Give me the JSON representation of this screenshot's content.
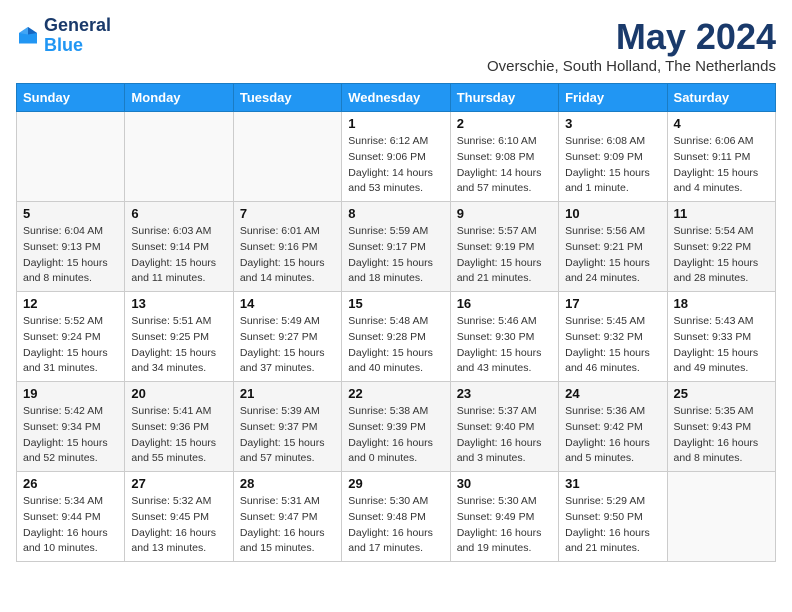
{
  "logo": {
    "line1": "General",
    "line2": "Blue"
  },
  "title": "May 2024",
  "subtitle": "Overschie, South Holland, The Netherlands",
  "days_of_week": [
    "Sunday",
    "Monday",
    "Tuesday",
    "Wednesday",
    "Thursday",
    "Friday",
    "Saturday"
  ],
  "weeks": [
    [
      {
        "day": "",
        "info": ""
      },
      {
        "day": "",
        "info": ""
      },
      {
        "day": "",
        "info": ""
      },
      {
        "day": "1",
        "info": "Sunrise: 6:12 AM\nSunset: 9:06 PM\nDaylight: 14 hours\nand 53 minutes."
      },
      {
        "day": "2",
        "info": "Sunrise: 6:10 AM\nSunset: 9:08 PM\nDaylight: 14 hours\nand 57 minutes."
      },
      {
        "day": "3",
        "info": "Sunrise: 6:08 AM\nSunset: 9:09 PM\nDaylight: 15 hours\nand 1 minute."
      },
      {
        "day": "4",
        "info": "Sunrise: 6:06 AM\nSunset: 9:11 PM\nDaylight: 15 hours\nand 4 minutes."
      }
    ],
    [
      {
        "day": "5",
        "info": "Sunrise: 6:04 AM\nSunset: 9:13 PM\nDaylight: 15 hours\nand 8 minutes."
      },
      {
        "day": "6",
        "info": "Sunrise: 6:03 AM\nSunset: 9:14 PM\nDaylight: 15 hours\nand 11 minutes."
      },
      {
        "day": "7",
        "info": "Sunrise: 6:01 AM\nSunset: 9:16 PM\nDaylight: 15 hours\nand 14 minutes."
      },
      {
        "day": "8",
        "info": "Sunrise: 5:59 AM\nSunset: 9:17 PM\nDaylight: 15 hours\nand 18 minutes."
      },
      {
        "day": "9",
        "info": "Sunrise: 5:57 AM\nSunset: 9:19 PM\nDaylight: 15 hours\nand 21 minutes."
      },
      {
        "day": "10",
        "info": "Sunrise: 5:56 AM\nSunset: 9:21 PM\nDaylight: 15 hours\nand 24 minutes."
      },
      {
        "day": "11",
        "info": "Sunrise: 5:54 AM\nSunset: 9:22 PM\nDaylight: 15 hours\nand 28 minutes."
      }
    ],
    [
      {
        "day": "12",
        "info": "Sunrise: 5:52 AM\nSunset: 9:24 PM\nDaylight: 15 hours\nand 31 minutes."
      },
      {
        "day": "13",
        "info": "Sunrise: 5:51 AM\nSunset: 9:25 PM\nDaylight: 15 hours\nand 34 minutes."
      },
      {
        "day": "14",
        "info": "Sunrise: 5:49 AM\nSunset: 9:27 PM\nDaylight: 15 hours\nand 37 minutes."
      },
      {
        "day": "15",
        "info": "Sunrise: 5:48 AM\nSunset: 9:28 PM\nDaylight: 15 hours\nand 40 minutes."
      },
      {
        "day": "16",
        "info": "Sunrise: 5:46 AM\nSunset: 9:30 PM\nDaylight: 15 hours\nand 43 minutes."
      },
      {
        "day": "17",
        "info": "Sunrise: 5:45 AM\nSunset: 9:32 PM\nDaylight: 15 hours\nand 46 minutes."
      },
      {
        "day": "18",
        "info": "Sunrise: 5:43 AM\nSunset: 9:33 PM\nDaylight: 15 hours\nand 49 minutes."
      }
    ],
    [
      {
        "day": "19",
        "info": "Sunrise: 5:42 AM\nSunset: 9:34 PM\nDaylight: 15 hours\nand 52 minutes."
      },
      {
        "day": "20",
        "info": "Sunrise: 5:41 AM\nSunset: 9:36 PM\nDaylight: 15 hours\nand 55 minutes."
      },
      {
        "day": "21",
        "info": "Sunrise: 5:39 AM\nSunset: 9:37 PM\nDaylight: 15 hours\nand 57 minutes."
      },
      {
        "day": "22",
        "info": "Sunrise: 5:38 AM\nSunset: 9:39 PM\nDaylight: 16 hours\nand 0 minutes."
      },
      {
        "day": "23",
        "info": "Sunrise: 5:37 AM\nSunset: 9:40 PM\nDaylight: 16 hours\nand 3 minutes."
      },
      {
        "day": "24",
        "info": "Sunrise: 5:36 AM\nSunset: 9:42 PM\nDaylight: 16 hours\nand 5 minutes."
      },
      {
        "day": "25",
        "info": "Sunrise: 5:35 AM\nSunset: 9:43 PM\nDaylight: 16 hours\nand 8 minutes."
      }
    ],
    [
      {
        "day": "26",
        "info": "Sunrise: 5:34 AM\nSunset: 9:44 PM\nDaylight: 16 hours\nand 10 minutes."
      },
      {
        "day": "27",
        "info": "Sunrise: 5:32 AM\nSunset: 9:45 PM\nDaylight: 16 hours\nand 13 minutes."
      },
      {
        "day": "28",
        "info": "Sunrise: 5:31 AM\nSunset: 9:47 PM\nDaylight: 16 hours\nand 15 minutes."
      },
      {
        "day": "29",
        "info": "Sunrise: 5:30 AM\nSunset: 9:48 PM\nDaylight: 16 hours\nand 17 minutes."
      },
      {
        "day": "30",
        "info": "Sunrise: 5:30 AM\nSunset: 9:49 PM\nDaylight: 16 hours\nand 19 minutes."
      },
      {
        "day": "31",
        "info": "Sunrise: 5:29 AM\nSunset: 9:50 PM\nDaylight: 16 hours\nand 21 minutes."
      },
      {
        "day": "",
        "info": ""
      }
    ]
  ]
}
